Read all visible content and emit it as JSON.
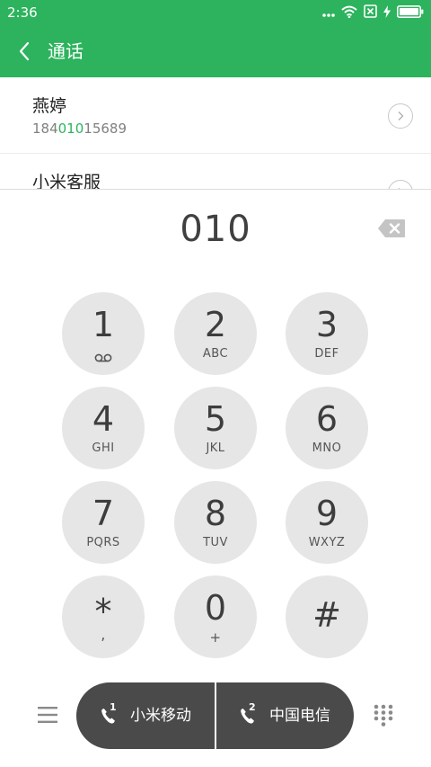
{
  "status_bar": {
    "time": "2:36",
    "icons": [
      "dots-icon",
      "wifi-icon",
      "no-sim-icon",
      "charging-icon",
      "battery-icon"
    ]
  },
  "app_bar": {
    "title": "通话",
    "back_icon": "chevron-left-icon"
  },
  "contacts": [
    {
      "name": "燕婷",
      "number_prefix": "184",
      "number_match": "010",
      "number_suffix": "15689"
    },
    {
      "name": "小米客服",
      "number_prefix": "",
      "number_match": "",
      "number_suffix": ""
    }
  ],
  "dialer": {
    "number": "010",
    "backspace_icon": "backspace-icon",
    "keys": [
      {
        "digit": "1",
        "letters": "",
        "icon": "voicemail-icon"
      },
      {
        "digit": "2",
        "letters": "ABC"
      },
      {
        "digit": "3",
        "letters": "DEF"
      },
      {
        "digit": "4",
        "letters": "GHI"
      },
      {
        "digit": "5",
        "letters": "JKL"
      },
      {
        "digit": "6",
        "letters": "MNO"
      },
      {
        "digit": "7",
        "letters": "PQRS"
      },
      {
        "digit": "8",
        "letters": "TUV"
      },
      {
        "digit": "9",
        "letters": "WXYZ"
      },
      {
        "digit": "*",
        "letters": ","
      },
      {
        "digit": "0",
        "letters": "+"
      },
      {
        "digit": "#",
        "letters": ""
      }
    ]
  },
  "bottom_bar": {
    "menu_icon": "menu-icon",
    "keypad_icon": "dialpad-icon",
    "sim1": {
      "slot": "1",
      "carrier": "小米移动"
    },
    "sim2": {
      "slot": "2",
      "carrier": "中国电信"
    }
  },
  "colors": {
    "accent": "#2db35d",
    "key_bg": "#e6e6e6",
    "call_bar": "#4a4a4a"
  }
}
